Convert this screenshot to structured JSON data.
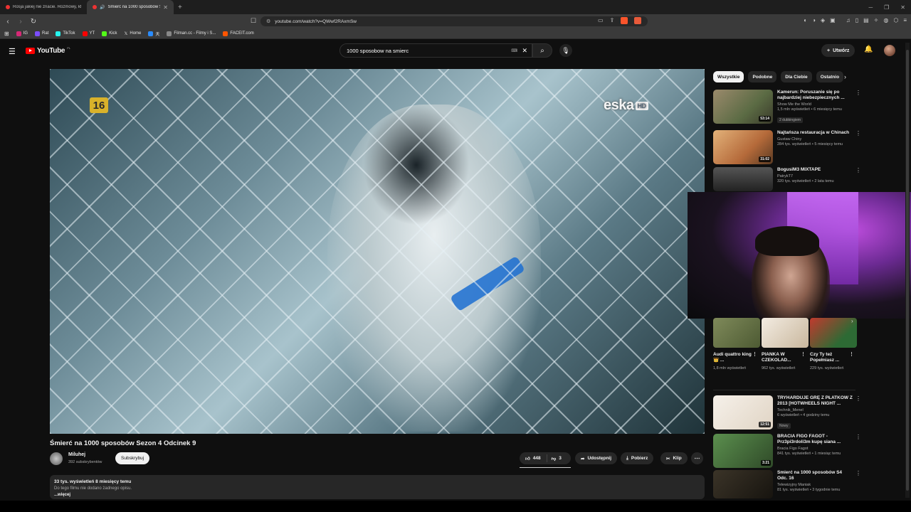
{
  "browser": {
    "tabs": [
      {
        "title": "Rosja jakiej nie znacie. Rozmowy, któ"
      },
      {
        "title": "Śmierć na 1000 sposobów Se"
      }
    ],
    "new_tab_icon": "plus-icon",
    "url": "youtube.com/watch?v=QWwf2RAxmSw",
    "bookmarks": [
      {
        "label": "IG",
        "color": "#d62976"
      },
      {
        "label": "Rat",
        "color": "#7b4dff"
      },
      {
        "label": "TikTok",
        "color": "#25f4ee"
      },
      {
        "label": "YT",
        "color": "#ff0000"
      },
      {
        "label": "Kick",
        "color": "#53fc18"
      },
      {
        "label": "Home",
        "color": "#ffffff"
      },
      {
        "label": "天",
        "color": "#2a8cff"
      },
      {
        "label": "Filman.cc - Filmy i S...",
        "color": "#888888"
      },
      {
        "label": "FACEIT.com",
        "color": "#ff5500"
      }
    ]
  },
  "youtube": {
    "logo_text": "YouTube",
    "country_code": "PL",
    "search_query": "1000 sposobow na smierc",
    "create_label": "Utwórz",
    "accent": "#ff0000"
  },
  "player": {
    "age_rating": "16",
    "channel_bug": "eska",
    "channel_bug_hd": "HD"
  },
  "video": {
    "title": "Śmierć na 1000 sposobów Sezon 4 Odcinek 9",
    "channel": "Miluhej",
    "subscribers": "392 subskrybentów",
    "subscribe_label": "Subskrybuj",
    "likes": "448",
    "dislikes": "3",
    "share_label": "Udostępnij",
    "download_label": "Pobierz",
    "clip_label": "Klip",
    "description_meta": "33 tys. wyświetleń  8 miesięcy temu",
    "description_text": "Do tego filmu nie dodano żadnego opisu.",
    "description_more": "...więcej"
  },
  "sidebar": {
    "chips": [
      "Wszystkie",
      "Podobne",
      "Dla Ciebie",
      "Ostatnio"
    ],
    "recommendations_top": [
      {
        "title": "Kamerun: Poruszanie się po najbardziej niebezpiecznych ...",
        "channel": "Show Me the World",
        "meta": "1,5 mln wyświetleń • 6 miesięcy temu",
        "badge": "2 dubbingiem",
        "duration": "53:14",
        "thumb": "#7a6a55"
      },
      {
        "title": "Najtańsza restauracja w Chinach",
        "channel": "Gustaw Chiny",
        "meta": "284 tys. wyświetleń • 5 miesięcy temu",
        "badge": "",
        "duration": "31:02",
        "thumb": "#c98a4a"
      },
      {
        "title": "BogusiM3 MIXTAPE",
        "channel": "PatrykT7",
        "meta": "320 tys. wyświetleń • 2 lata temu",
        "badge": "",
        "duration": "",
        "thumb": "#3a3a3a"
      }
    ],
    "shorts": [
      {
        "title": "Audi quattro king 👑 ...",
        "views": "1,8 mln wyświetleń",
        "thumb": "#6f7d4a"
      },
      {
        "title": "PIANKA W CZEKOLAD...",
        "views": "962 tys. wyświetleń",
        "thumb": "#e8e2d8"
      },
      {
        "title": "Czy Ty też Popełniasz ...",
        "views": "229 tys. wyświetleń",
        "thumb": "#b8322a"
      }
    ],
    "recommendations_bottom": [
      {
        "title": "TRYHARDUJE GRĘ Z PŁATKÓW Z 2013 [HOTWHEELS NIGHT ...",
        "channel": "Technik_Menel",
        "meta": "6 wyświetleń • 4 godziny temu",
        "badge": "Nowy",
        "duration": "12:51",
        "thumb": "#efe9e2"
      },
      {
        "title": "BRACIA FIGO FAGOT - Prz3pi3rdoli3m kupę siana ...",
        "channel": "Bracia Figo Fagot",
        "meta": "841 tys. wyświetleń • 1 miesiąc temu",
        "badge": "",
        "duration": "3:21",
        "thumb": "#3d6b3a"
      },
      {
        "title": "Śmierć na 1000 sposobów S4 Odc. 16",
        "channel": "Telewizyjny Maniak",
        "meta": "81 tys. wyświetleń • 3 tygodnie temu",
        "badge": "",
        "duration": "",
        "thumb": "#2b2620"
      }
    ]
  }
}
